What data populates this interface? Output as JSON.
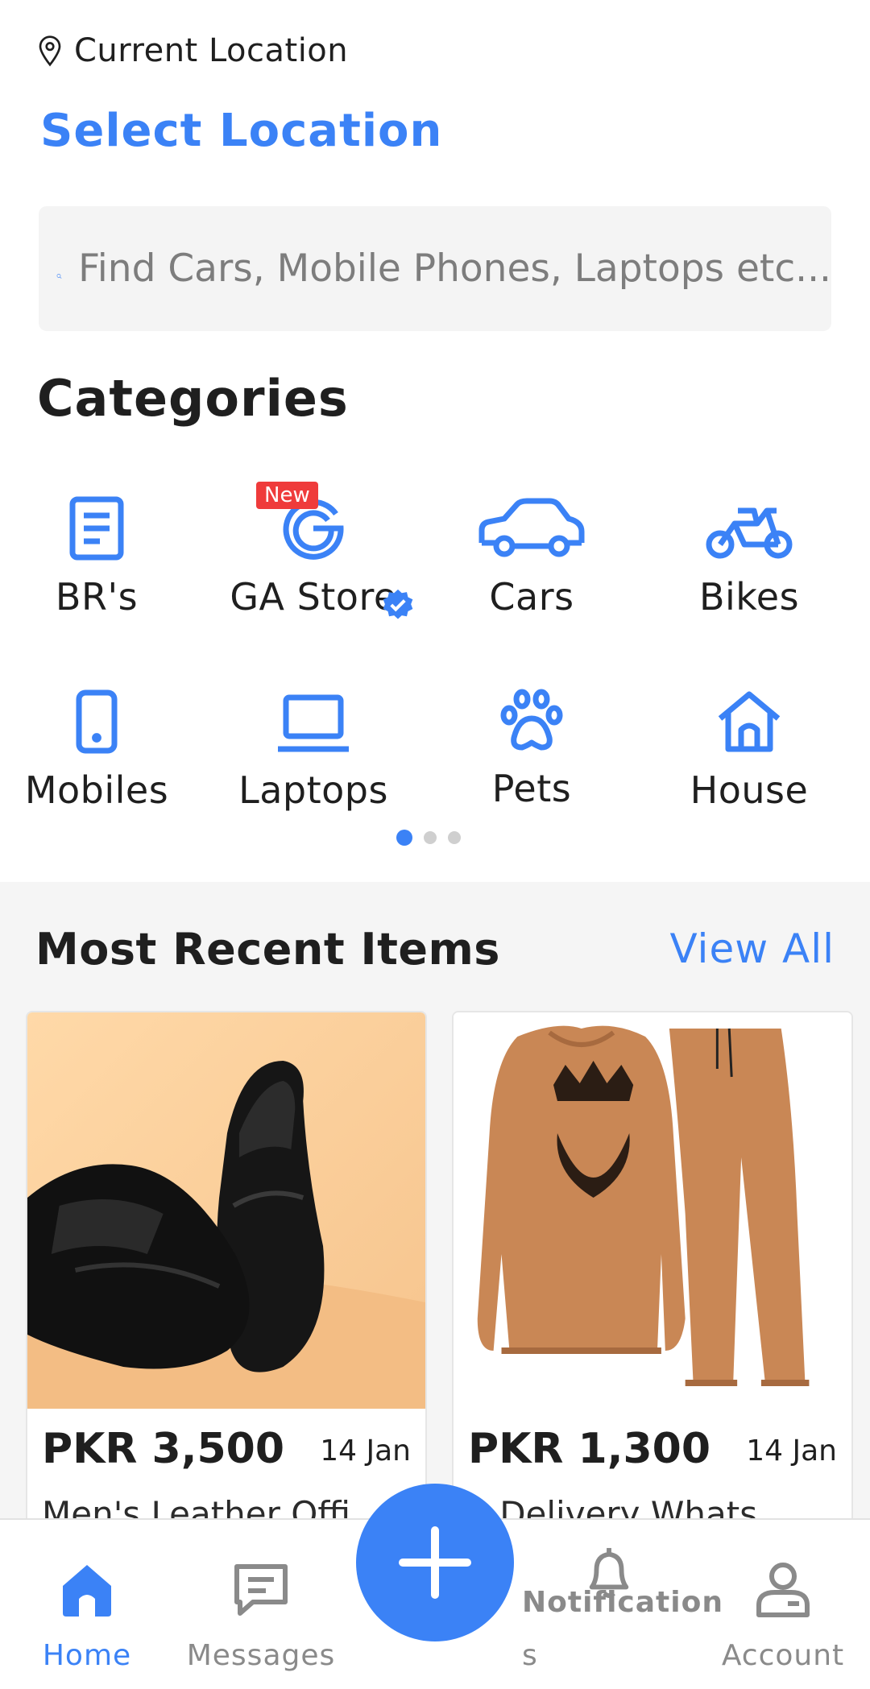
{
  "location": {
    "label": "Current Location",
    "select_label": "Select Location"
  },
  "search": {
    "placeholder": "Find Cars, Mobile Phones, Laptops etc..."
  },
  "categories": {
    "title": "Categories",
    "badge_new": "New",
    "items": [
      {
        "label": "BR's",
        "icon": "document-icon"
      },
      {
        "label": "GA Store",
        "icon": "ga-logo-icon"
      },
      {
        "label": "Cars",
        "icon": "car-icon"
      },
      {
        "label": "Bikes",
        "icon": "motorbike-icon"
      },
      {
        "label": "Mobiles",
        "icon": "mobile-phone-icon"
      },
      {
        "label": "Laptops",
        "icon": "laptop-icon"
      },
      {
        "label": "Pets",
        "icon": "paw-icon"
      },
      {
        "label": "House",
        "icon": "house-icon"
      }
    ],
    "pager": {
      "pages": 3,
      "active": 1
    }
  },
  "recent": {
    "title": "Most Recent Items",
    "view_all": "View All",
    "items": [
      {
        "price": "PKR 3,500",
        "date": "14 Jan",
        "title": "Men's Leather Offi..."
      },
      {
        "price": "PKR 1,300",
        "date": "14 Jan",
        "title": "e Delivery Whats..."
      }
    ]
  },
  "bottom_nav": {
    "home": "Home",
    "messages": "Messages",
    "notifications_l1": "Notification",
    "notifications_l2": "s",
    "account": "Account"
  },
  "colors": {
    "accent": "#3b82f6",
    "badge": "#ef3b3b",
    "section_bg": "#f5f5f5"
  }
}
